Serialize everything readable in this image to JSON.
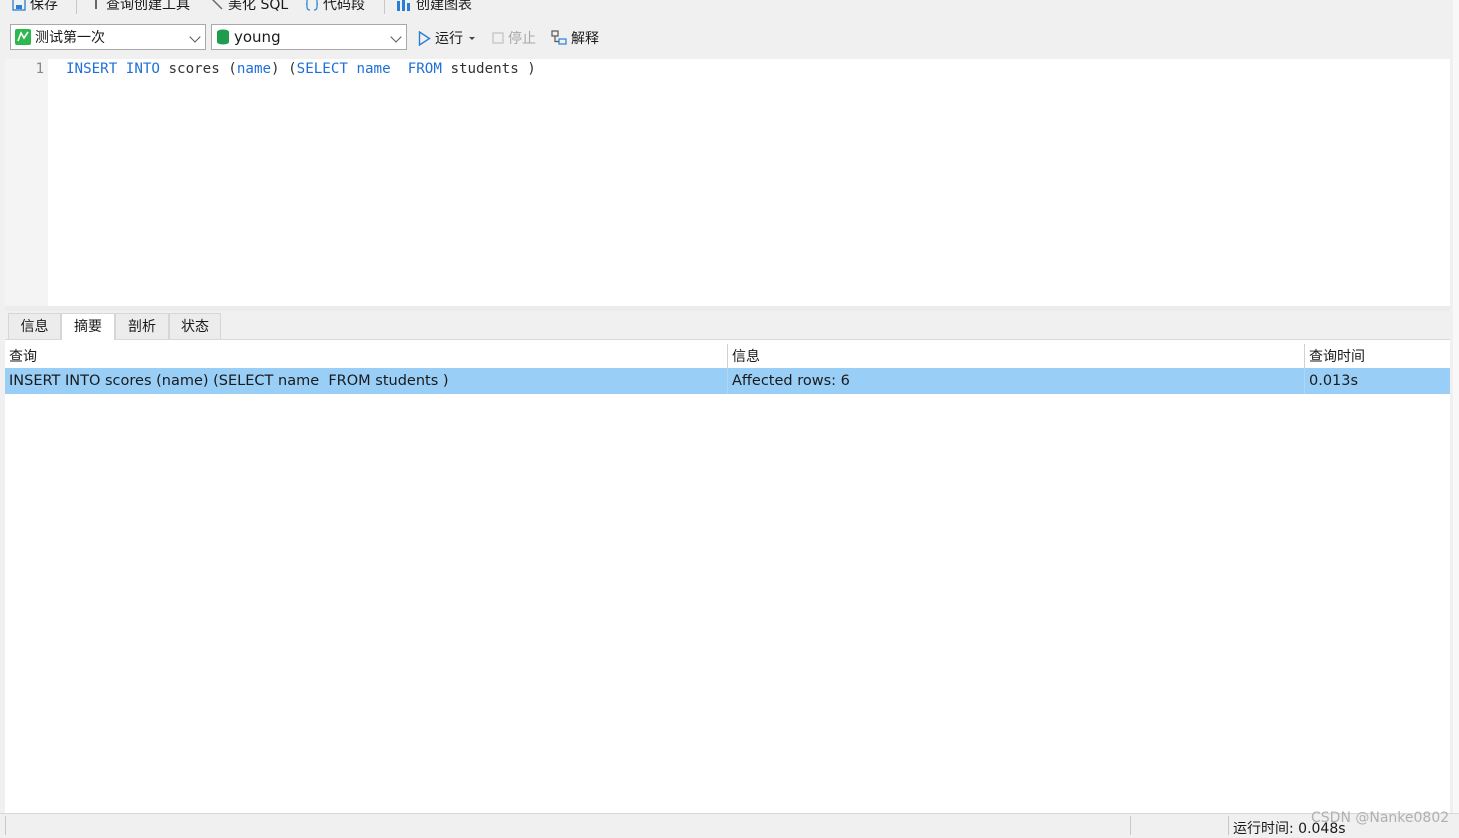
{
  "toolbar": {
    "save_label": "保存",
    "query_builder_label": "查询创建工具",
    "beautify_label": "美化 SQL",
    "snippet_label": "代码段",
    "chart_label": "创建图表"
  },
  "query_bar": {
    "connection": "测试第一次",
    "database": "young",
    "run_label": "运行",
    "stop_label": "停止",
    "explain_label": "解释"
  },
  "editor": {
    "line_number": "1",
    "tokens": {
      "t1": "INSERT",
      "t2": "INTO",
      "t3": "scores (",
      "t4": "name",
      "t5": ") (",
      "t6": "SELECT",
      "t7": "name",
      "t8": "FROM",
      "t9": "students )"
    }
  },
  "result_tabs": [
    "信息",
    "摘要",
    "剖析",
    "状态"
  ],
  "active_tab": "摘要",
  "grid": {
    "headers": [
      "查询",
      "信息",
      "查询时间"
    ],
    "row": {
      "query": "INSERT INTO scores (name) (SELECT name  FROM students )",
      "info": "Affected rows: 6",
      "time": "0.013s"
    }
  },
  "status": {
    "runtime": "运行时间: 0.048s",
    "watermark": "CSDN @Nanke0802"
  },
  "colors": {
    "keyword": "#1e6fd9",
    "selected_row": "#99cff7",
    "connection_icon": "#2db84d",
    "db_icon": "#1f9d4c",
    "accent": "#2a7fd4"
  }
}
